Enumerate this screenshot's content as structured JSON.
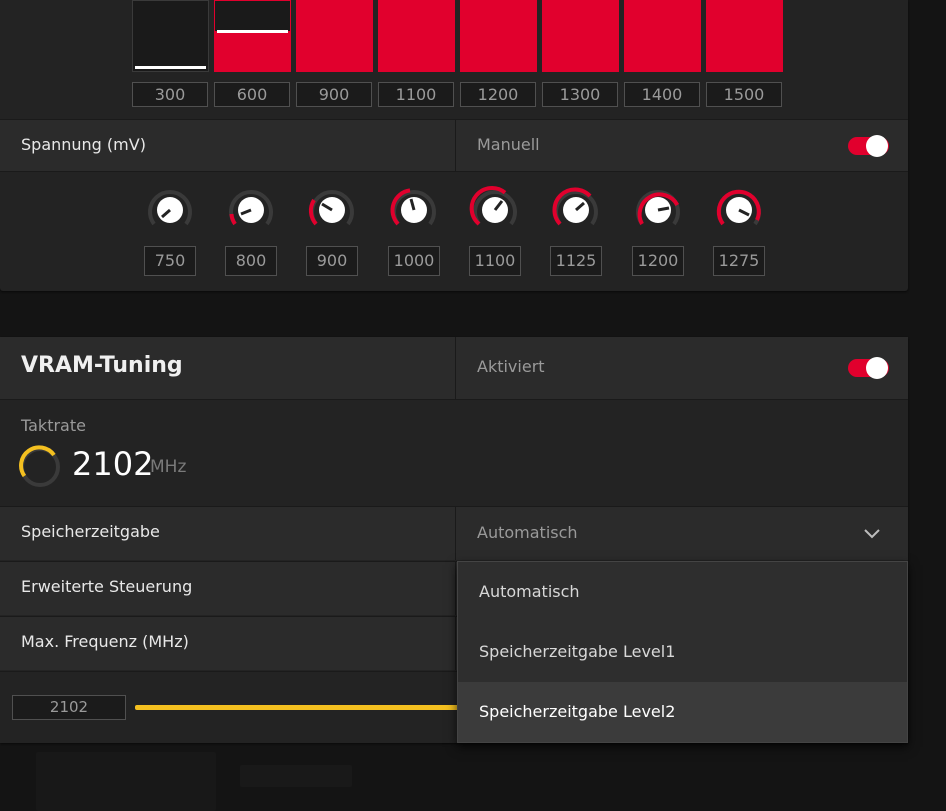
{
  "colors": {
    "accent": "#e1002d",
    "clock_accent": "#f4c020",
    "panel": "#232323",
    "row": "#2b2b2b"
  },
  "frequency": {
    "bars": [
      {
        "label": "300"
      },
      {
        "label": "600"
      },
      {
        "label": "900"
      },
      {
        "label": "1100"
      },
      {
        "label": "1200"
      },
      {
        "label": "1300"
      },
      {
        "label": "1400"
      },
      {
        "label": "1500"
      }
    ]
  },
  "voltage": {
    "label": "Spannung (mV)",
    "mode": "Manuell",
    "toggle_icon": "toggle-on",
    "knobs": [
      {
        "value": "750"
      },
      {
        "value": "800"
      },
      {
        "value": "900"
      },
      {
        "value": "1000"
      },
      {
        "value": "1100"
      },
      {
        "value": "1125"
      },
      {
        "value": "1200"
      },
      {
        "value": "1275"
      }
    ]
  },
  "vram": {
    "title": "VRAM-Tuning",
    "status": "Aktiviert",
    "clock": {
      "label": "Taktrate",
      "value": "2102",
      "unit": "MHz",
      "icon": "gauge-ring-icon"
    },
    "memory_timing": {
      "label": "Speicherzeitgabe",
      "value": "Automatisch",
      "icon": "chevron-down-icon"
    },
    "advanced_control": {
      "label": "Erweiterte Steuerung"
    },
    "max_frequency": {
      "label": "Max. Frequenz (MHz)",
      "value": "2102"
    },
    "dropdown": {
      "options": [
        "Automatisch",
        "Speicherzeitgabe Level1",
        "Speicherzeitgabe Level2"
      ],
      "highlighted": "Speicherzeitgabe Level2"
    }
  }
}
